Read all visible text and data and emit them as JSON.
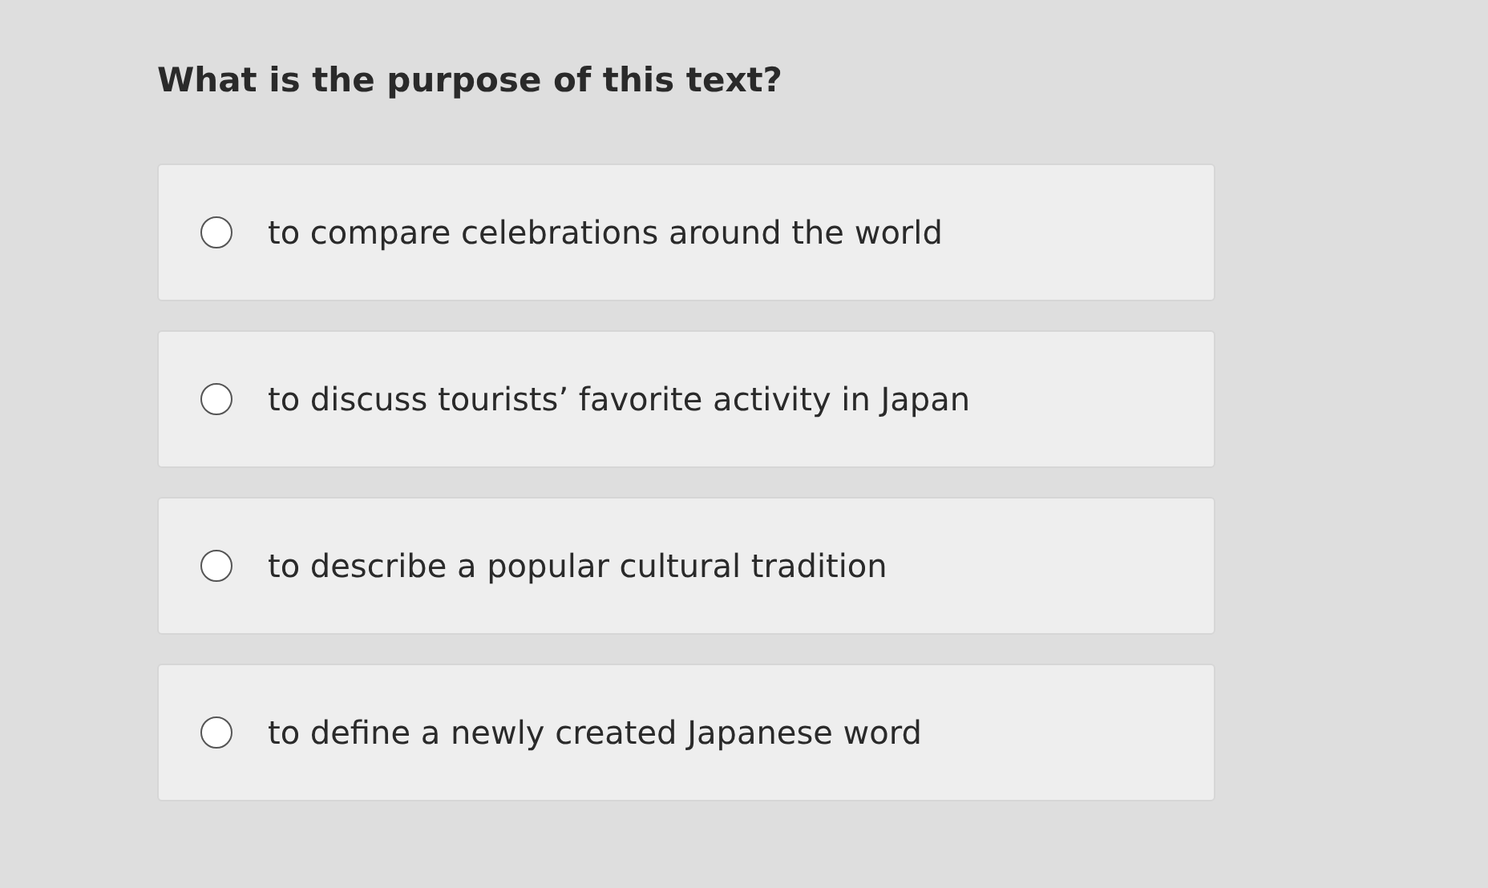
{
  "question": "What is the purpose of this text?",
  "options": [
    {
      "label": "to compare celebrations around the world",
      "selected": false
    },
    {
      "label": "to discuss tourists’ favorite activity in Japan",
      "selected": false
    },
    {
      "label": "to describe a popular cultural tradition",
      "selected": false
    },
    {
      "label": "to define a newly created Japanese word",
      "selected": false
    }
  ]
}
